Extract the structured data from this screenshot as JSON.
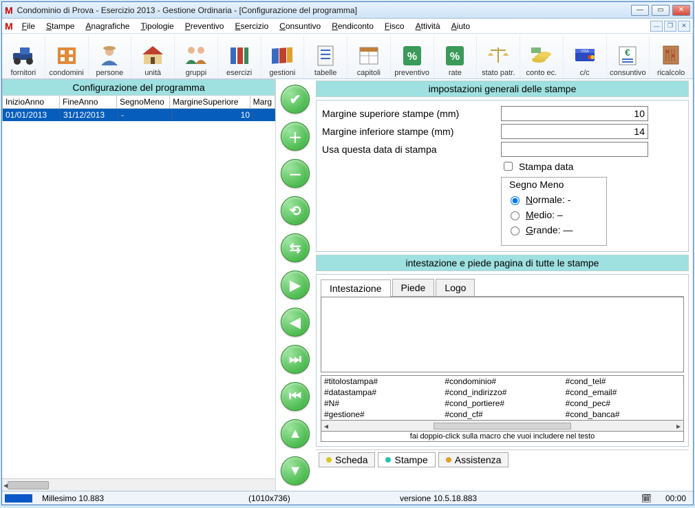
{
  "window": {
    "title": "Condominio di Prova - Esercizio 2013 - Gestione Ordinaria - [Configurazione del programma]"
  },
  "menu": [
    "File",
    "Stampe",
    "Anagrafiche",
    "Tipologie",
    "Preventivo",
    "Esercizio",
    "Consuntivo",
    "Rendiconto",
    "Fisco",
    "Attività",
    "Aiuto"
  ],
  "toolbar": [
    {
      "label": "fornitori"
    },
    {
      "label": "condomini"
    },
    {
      "label": "persone"
    },
    {
      "label": "unità"
    },
    {
      "label": "gruppi"
    },
    {
      "label": "esercizi"
    },
    {
      "label": "gestioni"
    },
    {
      "label": "tabelle"
    },
    {
      "label": "capitoli"
    },
    {
      "label": "preventivo"
    },
    {
      "label": "rate"
    },
    {
      "label": "stato patr."
    },
    {
      "label": "conto ec."
    },
    {
      "label": "c/c"
    },
    {
      "label": "consuntivo"
    },
    {
      "label": "ricalcolo"
    }
  ],
  "left": {
    "title": "Configurazione del programma",
    "cols": [
      "InizioAnno",
      "FineAnno",
      "SegnoMeno",
      "MargineSuperiore",
      "Marg"
    ],
    "row": [
      "01/01/2013",
      "31/12/2013",
      "-",
      "10",
      ""
    ]
  },
  "stampe": {
    "panelTitle": "impostazioni generali delle stampe",
    "margSupLabel": "Margine superiore stampe (mm)",
    "margSup": "10",
    "margInfLabel": "Margine inferiore stampe (mm)",
    "margInf": "14",
    "usaDataLabel": "Usa questa data di stampa",
    "usaData": "",
    "stampaDataLabel": "Stampa data",
    "segnoTitle": "Segno Meno",
    "radioNormale": "Normale: -",
    "radioMedio": "Medio: –",
    "radioGrande": "Grande: —"
  },
  "intestazione": {
    "panelTitle": "intestazione e piede pagina di tutte le stampe",
    "tabs": [
      "Intestazione",
      "Piede",
      "Logo"
    ],
    "macros": [
      [
        "#titolostampa#",
        "#condominio#",
        "#cond_tel#"
      ],
      [
        "#datastampa#",
        "#cond_indirizzo#",
        "#cond_email#"
      ],
      [
        "#N#",
        "#cond_portiere#",
        "#cond_pec#"
      ],
      [
        "#gestione#",
        "#cond_cf#",
        "#cond_banca#"
      ]
    ],
    "hint": "fai doppio-click sulla macro che vuoi includere nel testo"
  },
  "bottomTabs": [
    {
      "label": "Scheda",
      "color": "#d8c723"
    },
    {
      "label": "Stampe",
      "color": "#26c2b1"
    },
    {
      "label": "Assistenza",
      "color": "#e0a12b"
    }
  ],
  "status": {
    "millesimo": "Millesimo 10.883",
    "dim": "(1010x736)",
    "versione": "versione 10.5.18.883",
    "time": "00:00"
  }
}
